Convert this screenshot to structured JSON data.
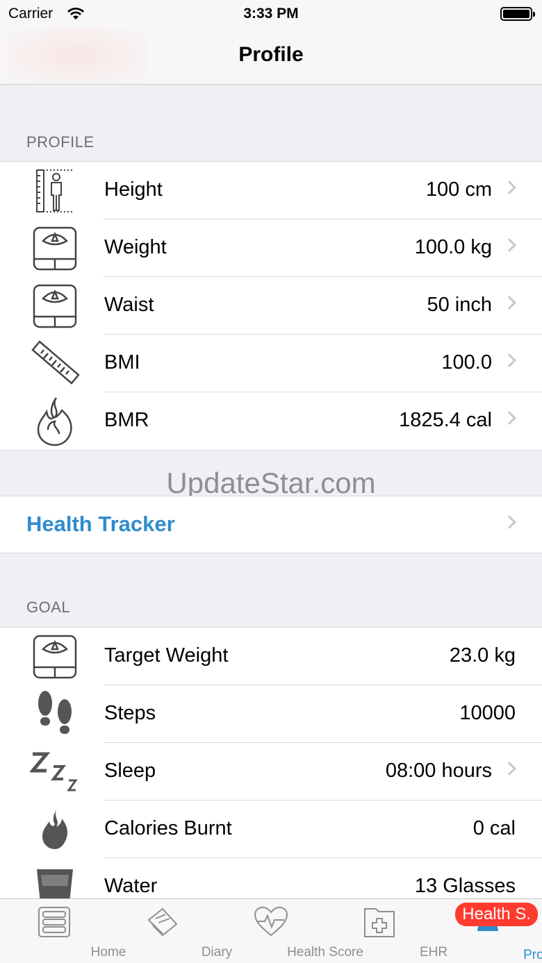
{
  "status_bar": {
    "carrier": "Carrier",
    "time": "3:33 PM"
  },
  "nav": {
    "title": "Profile"
  },
  "profile_section": {
    "header": "PROFILE",
    "rows": [
      {
        "label": "Height",
        "value": "100 cm",
        "icon": "height-measure-icon"
      },
      {
        "label": "Weight",
        "value": "100.0 kg",
        "icon": "scale-icon"
      },
      {
        "label": "Waist",
        "value": "50 inch",
        "icon": "scale-icon"
      },
      {
        "label": "BMI",
        "value": "100.0",
        "icon": "ruler-icon"
      },
      {
        "label": "BMR",
        "value": "1825.4 cal",
        "icon": "flame-outline-icon"
      }
    ]
  },
  "watermark": "UpdateStar.com",
  "health_tracker": {
    "label": "Health Tracker"
  },
  "goal_section": {
    "header": "GOAL",
    "rows": [
      {
        "label": "Target Weight",
        "value": "23.0 kg",
        "icon": "scale-icon"
      },
      {
        "label": "Steps",
        "value": "10000",
        "icon": "footprints-icon"
      },
      {
        "label": "Sleep",
        "value": "08:00 hours",
        "icon": "sleep-zzz-icon"
      },
      {
        "label": "Calories Burnt",
        "value": "0 cal",
        "icon": "flame-filled-icon"
      },
      {
        "label": "Water",
        "value": "13 Glasses",
        "icon": "water-glass-icon"
      }
    ]
  },
  "tab_bar": {
    "tabs": [
      {
        "label": "Home",
        "icon": "home-list-icon"
      },
      {
        "label": "Diary",
        "icon": "diary-book-icon"
      },
      {
        "label": "Health Score",
        "icon": "heart-pulse-icon"
      },
      {
        "label": "EHR",
        "icon": "medical-folder-icon"
      },
      {
        "label": "Profile",
        "icon": "profile-icon"
      }
    ],
    "active_tab": "Profile",
    "badge": "Health S."
  },
  "colors": {
    "accent": "#2f8ccc",
    "badge": "#ff3b30",
    "background": "#efeff4"
  }
}
